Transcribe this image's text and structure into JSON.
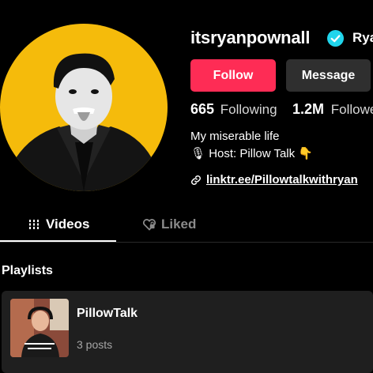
{
  "profile": {
    "username": "itsryanpownall",
    "nickname": "Rya",
    "follow_label": "Follow",
    "message_label": "Message",
    "following_count": "665",
    "following_label": "Following",
    "followers_count": "1.2M",
    "followers_label": "Followe",
    "bio_line1": "My miserable life",
    "bio_line2_mic": "🎙",
    "bio_line2_text": "Host: Pillow Talk",
    "bio_line2_emoji": "👇",
    "link": "linktr.ee/Pillowtalkwithryan"
  },
  "tabs": [
    {
      "label": "Videos",
      "icon": "grid-icon",
      "active": true
    },
    {
      "label": "Liked",
      "icon": "heart-lock-icon",
      "active": false
    }
  ],
  "playlists": {
    "title": "Playlists",
    "items": [
      {
        "name": "PillowTalk",
        "count": "3 posts"
      }
    ]
  },
  "colors": {
    "accent": "#fe2c55",
    "avatar_bg": "#f5bb0b",
    "verified": "#20d5ec",
    "button_secondary": "#2f2f2f",
    "card_bg": "#1f1f1f"
  }
}
